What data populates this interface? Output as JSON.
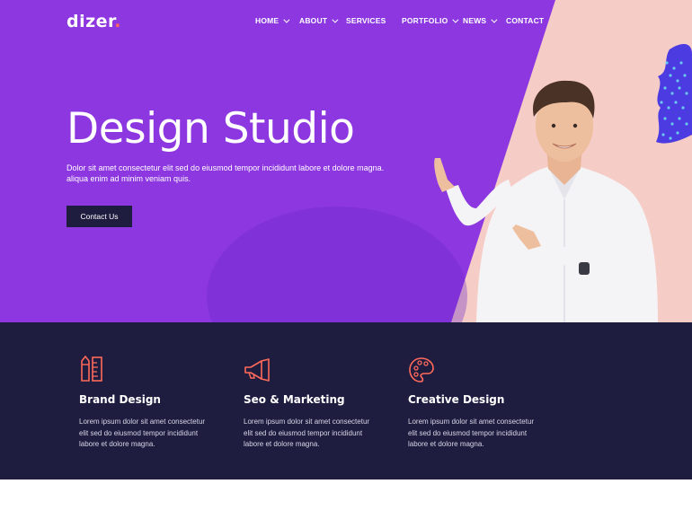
{
  "brand": {
    "name": "dizer",
    "dot": "."
  },
  "nav": [
    {
      "label": "HOME",
      "dropdown": true
    },
    {
      "label": "ABOUT",
      "dropdown": true
    },
    {
      "label": "SERVICES",
      "dropdown": false
    },
    {
      "label": "PORTFOLIO",
      "dropdown": true
    },
    {
      "label": "NEWS",
      "dropdown": true
    },
    {
      "label": "CONTACT",
      "dropdown": false
    }
  ],
  "hero": {
    "title": "Design Studio",
    "text": "Dolor sit amet consectetur elit sed do eiusmod tempor incididunt labore et dolore magna. aliqua enim ad minim veniam quis.",
    "button": "Contact Us"
  },
  "services": [
    {
      "icon": "pencil-ruler-icon",
      "title": "Brand Design",
      "text": "Lorem ipsum dolor sit amet consectetur elit sed do eiusmod tempor incididunt labore et dolore magna."
    },
    {
      "icon": "megaphone-icon",
      "title": "Seo & Marketing",
      "text": "Lorem ipsum dolor sit amet consectetur elit sed do eiusmod tempor incididunt labore et dolore magna."
    },
    {
      "icon": "palette-icon",
      "title": "Creative Design",
      "text": "Lorem ipsum dolor sit amet consectetur elit sed do eiusmod tempor incididunt labore et dolore magna."
    }
  ],
  "colors": {
    "purple": "#8d37e0",
    "pink": "#f6ccc7",
    "navy": "#1f1d3f",
    "accent": "#ff6a5a",
    "halftone": "#4b3be0"
  }
}
